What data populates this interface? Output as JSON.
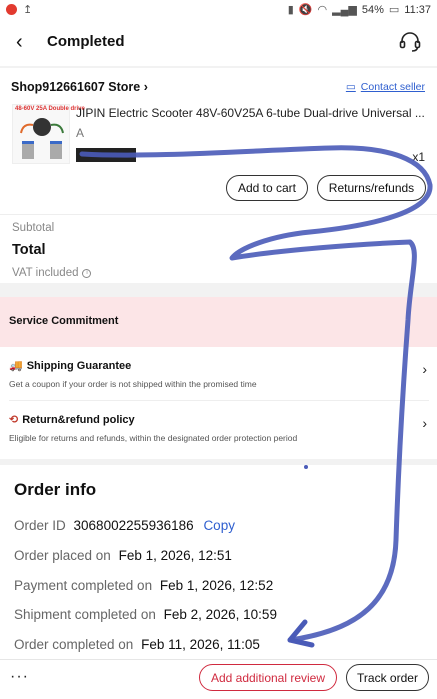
{
  "status_bar": {
    "battery": "54%",
    "time": "11:37"
  },
  "header": {
    "back_icon": "back-arrow-icon",
    "title": "Completed",
    "support_icon": "headset-icon"
  },
  "store": {
    "name": "Shop912661607 Store",
    "contact_label": "Contact seller"
  },
  "product": {
    "thumb_label": "48-60V 25A Double drive",
    "title": "JIPIN Electric Scooter 48V-60V25A 6-tube Dual-drive Universal ...",
    "variant": "A",
    "quantity": "x1",
    "add_to_cart": "Add to cart",
    "returns": "Returns/refunds"
  },
  "summary": {
    "subtotal_label": "Subtotal",
    "total_label": "Total",
    "vat_label": "VAT included"
  },
  "service": {
    "heading": "Service Commitment",
    "items": [
      {
        "icon": "truck-icon",
        "title": "Shipping Guarantee",
        "desc": "Get a coupon if your order is not shipped within the promised time"
      },
      {
        "icon": "refund-icon",
        "title": "Return&refund policy",
        "desc": "Eligible for returns and refunds, within the designated order protection period"
      }
    ]
  },
  "order_info": {
    "title": "Order info",
    "order_id_label": "Order ID",
    "order_id": "3068002255936186",
    "copy_label": "Copy",
    "rows": [
      {
        "label": "Order placed on",
        "value": "Feb 1, 2026, 12:51"
      },
      {
        "label": "Payment completed on",
        "value": "Feb 1, 2026, 12:52"
      },
      {
        "label": "Shipment completed on",
        "value": "Feb 2, 2026, 10:59"
      },
      {
        "label": "Order completed on",
        "value": "Feb 11, 2026, 11:05"
      }
    ]
  },
  "bottom": {
    "more": "···",
    "review": "Add additional review",
    "track": "Track order"
  },
  "colors": {
    "accent_red": "#d02a3f",
    "link_blue": "#2f5fcf",
    "service_bg": "#fce5e7",
    "scribble": "#4a5bb8"
  }
}
